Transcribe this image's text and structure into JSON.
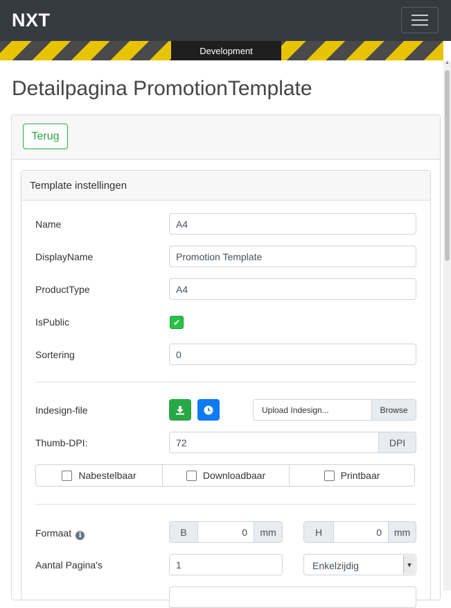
{
  "navbar": {
    "brand": "NXT",
    "menu_icon": "hamburger-menu-icon"
  },
  "environment": {
    "label": "Development",
    "stripe_colors": [
      "#e8c400",
      "#4a4a4a"
    ]
  },
  "page": {
    "title": "Detailpagina PromotionTemplate"
  },
  "toolbar": {
    "back_label": "Terug"
  },
  "panel": {
    "title": "Template instellingen"
  },
  "fields": {
    "name": {
      "label": "Name",
      "value": "A4"
    },
    "display_name": {
      "label": "DisplayName",
      "value": "Promotion Template"
    },
    "product_type": {
      "label": "ProductType",
      "value": "A4"
    },
    "is_public": {
      "label": "IsPublic",
      "checked": true
    },
    "sortering": {
      "label": "Sortering",
      "value": "0"
    }
  },
  "indesign": {
    "label": "Indesign-file",
    "download_icon": "download-icon",
    "history_icon": "clock-icon",
    "upload_placeholder": "Upload Indesign...",
    "browse_label": "Browse"
  },
  "thumb_dpi": {
    "label": "Thumb-DPI:",
    "value": "72",
    "unit": "DPI"
  },
  "options": [
    {
      "label": "Nabestelbaar",
      "checked": false
    },
    {
      "label": "Downloadbaar",
      "checked": false
    },
    {
      "label": "Printbaar",
      "checked": false
    }
  ],
  "formaat": {
    "label": "Formaat",
    "width_prefix": "B",
    "width_value": "0",
    "width_unit": "mm",
    "height_prefix": "H",
    "height_value": "0",
    "height_unit": "mm"
  },
  "pages": {
    "label": "Aantal Pagina's",
    "value": "1",
    "sided_selected": "Enkelzijdig"
  },
  "colors": {
    "success": "#28a745",
    "primary": "#0d7bf4",
    "navbar": "#343a40"
  }
}
